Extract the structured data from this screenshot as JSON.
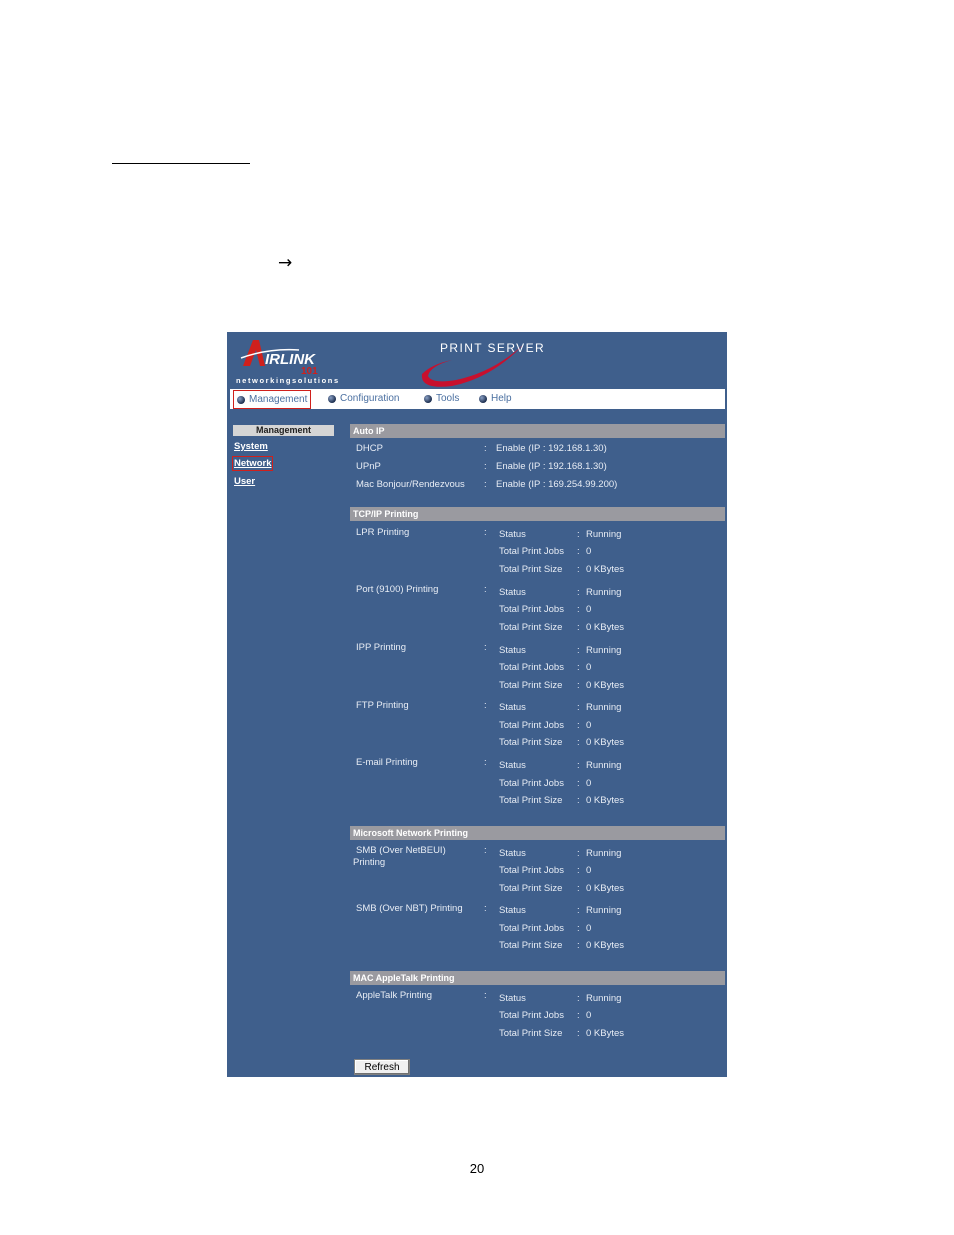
{
  "page": {
    "arrow_glyph": "→",
    "page_number": "20"
  },
  "header": {
    "logo_text": "AIRLINK",
    "logo_sub": "101",
    "tagline": "networkingsolutions",
    "product_title": "PRINT SERVER"
  },
  "nav": [
    {
      "label": "Management",
      "highlighted": true
    },
    {
      "label": "Configuration",
      "highlighted": false
    },
    {
      "label": "Tools",
      "highlighted": false
    },
    {
      "label": "Help",
      "highlighted": false
    }
  ],
  "sidebar": {
    "heading": "Management",
    "links": [
      {
        "label": "System",
        "highlighted": false
      },
      {
        "label": "Network",
        "highlighted": true
      },
      {
        "label": "User",
        "highlighted": false
      }
    ]
  },
  "auto_ip": {
    "title": "Auto IP",
    "rows": [
      {
        "label": "DHCP",
        "value": "Enable  (IP : 192.168.1.30)"
      },
      {
        "label": "UPnP",
        "value": "Enable  (IP : 192.168.1.30)"
      },
      {
        "label": "Mac Bonjour/Rendezvous",
        "value": "Enable  (IP : 169.254.99.200)"
      }
    ]
  },
  "stat_labels": {
    "status": "Status",
    "jobs": "Total Print Jobs",
    "size": "Total Print Size",
    "colon": ":"
  },
  "tcpip": {
    "title": "TCP/IP Printing",
    "services": [
      {
        "name": "LPR Printing",
        "status": "Running",
        "jobs": "0",
        "size": "0 KBytes"
      },
      {
        "name": "Port (9100) Printing",
        "status": "Running",
        "jobs": "0",
        "size": "0 KBytes"
      },
      {
        "name": "IPP Printing",
        "status": "Running",
        "jobs": "0",
        "size": "0 KBytes"
      },
      {
        "name": "FTP Printing",
        "status": "Running",
        "jobs": "0",
        "size": "0 KBytes"
      },
      {
        "name": "E-mail Printing",
        "status": "Running",
        "jobs": "0",
        "size": "0 KBytes"
      }
    ]
  },
  "microsoft": {
    "title": "Microsoft Network Printing",
    "services": [
      {
        "name": "SMB (Over NetBEUI)",
        "name2": "Printing",
        "status": "Running",
        "jobs": "0",
        "size": "0 KBytes"
      },
      {
        "name": "SMB (Over NBT) Printing",
        "status": "Running",
        "jobs": "0",
        "size": "0 KBytes"
      }
    ]
  },
  "appletalk": {
    "title": "MAC AppleTalk Printing",
    "services": [
      {
        "name": "AppleTalk Printing",
        "status": "Running",
        "jobs": "0",
        "size": "0 KBytes"
      }
    ]
  },
  "refresh_label": "Refresh"
}
